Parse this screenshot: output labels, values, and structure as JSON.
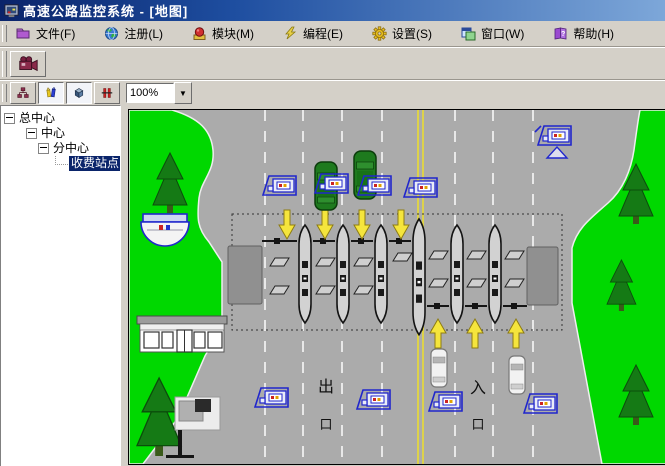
{
  "window": {
    "title": "高速公路监控系统 - [地图]"
  },
  "menu": {
    "items": [
      {
        "label": "文件(F)",
        "icon": "file-icon"
      },
      {
        "label": "注册(L)",
        "icon": "register-globe-icon"
      },
      {
        "label": "模块(M)",
        "icon": "module-icon"
      },
      {
        "label": "编程(E)",
        "icon": "program-lightning-icon"
      },
      {
        "label": "设置(S)",
        "icon": "settings-gear-icon"
      },
      {
        "label": "窗口(W)",
        "icon": "window-icon"
      },
      {
        "label": "帮助(H)",
        "icon": "help-book-icon"
      }
    ]
  },
  "toolbar": {
    "video_button_icon": "camcorder-icon",
    "view_button_icons": [
      "org-tree-icon",
      "draw-pens-icon",
      "cube-3d-icon",
      "gate-pillars-icon"
    ],
    "pressed_buttons": [
      "draw-pens-icon",
      "cube-3d-icon"
    ],
    "zoom_value": "100%"
  },
  "tree": {
    "items": [
      {
        "label": "总中心",
        "level": 0,
        "selected": false
      },
      {
        "label": "中心",
        "level": 1,
        "selected": false
      },
      {
        "label": "分中心",
        "level": 2,
        "selected": false
      },
      {
        "label": "收费站点",
        "level": 3,
        "selected": true
      }
    ]
  },
  "map": {
    "exit_label": "出口",
    "exit_chars": [
      "出",
      "口"
    ],
    "entrance_label": "入口",
    "entrance_chars": [
      "入",
      "口"
    ]
  },
  "colors": {
    "titlebar_left": "#0a246a",
    "titlebar_right": "#7da7d9",
    "chrome": "#d4d0c8",
    "selection": "#0a246a",
    "grass_green": "#00d800",
    "road_gray": "#ababab",
    "tree_green": "#157a15",
    "camera_blue": "#2026cc",
    "arrow_yellow": "#f5e53c",
    "center_line_yellow": "#ddd24a"
  }
}
